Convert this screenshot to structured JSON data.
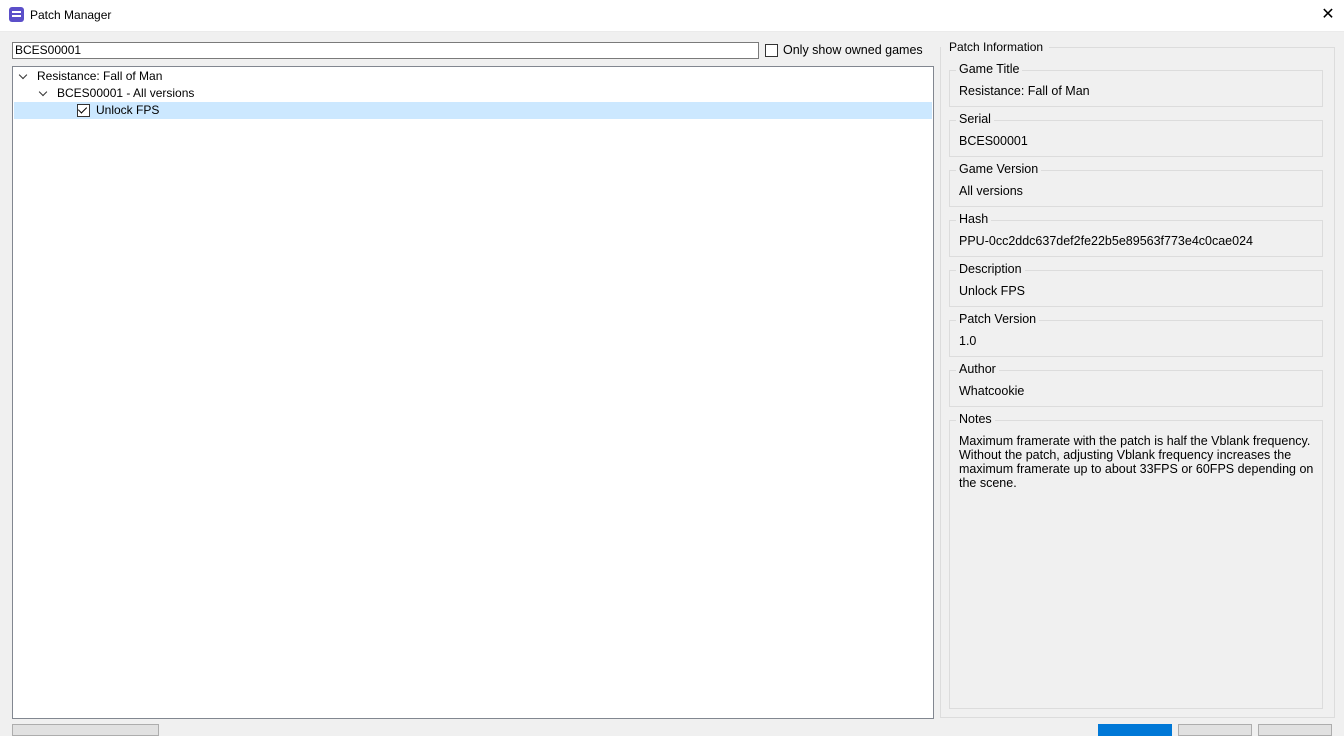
{
  "window": {
    "title": "Patch Manager",
    "app_icon": "rpcs3-app-icon",
    "close_icon": "close-icon"
  },
  "filter": {
    "search_value": "BCES00001",
    "owned_checkbox_label": "Only show owned games",
    "owned_checked": false
  },
  "tree": {
    "game": "Resistance: Fall of Man",
    "serial_node": "BCES00001 - All versions",
    "patch": "Unlock FPS",
    "patch_checked": true
  },
  "info": {
    "group_title": "Patch Information",
    "fields": [
      {
        "label": "Game Title",
        "value": "Resistance: Fall of Man"
      },
      {
        "label": "Serial",
        "value": "BCES00001"
      },
      {
        "label": "Game Version",
        "value": "All versions"
      },
      {
        "label": "Hash",
        "value": "PPU-0cc2ddc637def2fe22b5e89563f773e4c0cae024"
      },
      {
        "label": "Description",
        "value": "Unlock FPS"
      },
      {
        "label": "Patch Version",
        "value": "1.0"
      },
      {
        "label": "Author",
        "value": "Whatcookie"
      }
    ],
    "notes_label": "Notes",
    "notes_value": "Maximum framerate with the patch is half the Vblank frequency. Without the patch, adjusting Vblank frequency increases the maximum framerate up to about 33FPS or 60FPS depending on the scene."
  },
  "colors": {
    "selection": "#cce8ff",
    "primary_button": "#0078d7",
    "background": "#f0f0f0"
  }
}
